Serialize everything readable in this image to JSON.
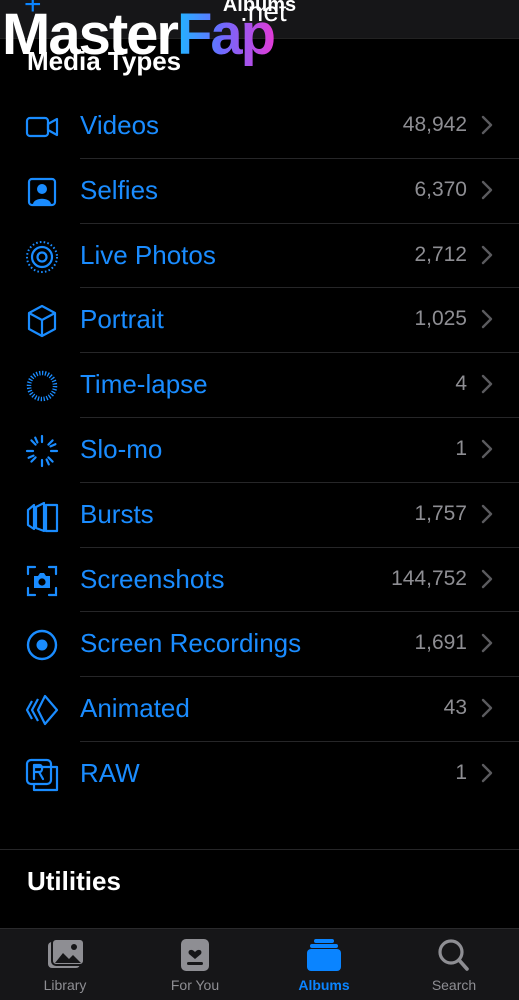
{
  "navbar": {
    "title": "Albums",
    "add_icon": "plus-icon"
  },
  "watermark": {
    "master": "Master",
    "fap": "Fap",
    "net": ".net"
  },
  "sections": {
    "media_types": "Media Types",
    "utilities": "Utilities"
  },
  "colors": {
    "accent": "#0a84ff",
    "label": "#1a8cff",
    "count": "#8e8e93",
    "background": "#000000",
    "bar": "#161618"
  },
  "media_types": [
    {
      "label": "Videos",
      "count": "48,942",
      "icon": "video-camera-icon"
    },
    {
      "label": "Selfies",
      "count": "6,370",
      "icon": "selfie-portrait-icon"
    },
    {
      "label": "Live Photos",
      "count": "2,712",
      "icon": "live-photo-icon"
    },
    {
      "label": "Portrait",
      "count": "1,025",
      "icon": "cube-icon"
    },
    {
      "label": "Time-lapse",
      "count": "4",
      "icon": "time-lapse-icon"
    },
    {
      "label": "Slo-mo",
      "count": "1",
      "icon": "slo-mo-icon"
    },
    {
      "label": "Bursts",
      "count": "1,757",
      "icon": "bursts-icon"
    },
    {
      "label": "Screenshots",
      "count": "144,752",
      "icon": "screenshot-camera-icon"
    },
    {
      "label": "Screen Recordings",
      "count": "1,691",
      "icon": "screen-recording-icon"
    },
    {
      "label": "Animated",
      "count": "43",
      "icon": "animated-icon"
    },
    {
      "label": "RAW",
      "count": "1",
      "icon": "raw-icon"
    }
  ],
  "tabs": [
    {
      "label": "Library",
      "icon": "photos-library-icon",
      "active": false
    },
    {
      "label": "For You",
      "icon": "for-you-icon",
      "active": false
    },
    {
      "label": "Albums",
      "icon": "albums-icon",
      "active": true
    },
    {
      "label": "Search",
      "icon": "search-icon",
      "active": false
    }
  ]
}
